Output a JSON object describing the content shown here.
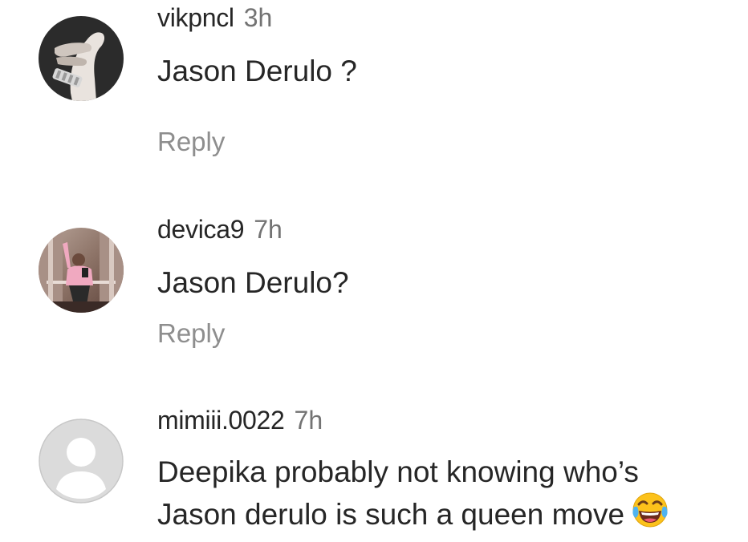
{
  "comments": [
    {
      "username": "vikpncl",
      "time": "3h",
      "text": "Jason Derulo ?",
      "reply_label": "Reply",
      "avatar_icon": "holding-hands-avatar-icon"
    },
    {
      "username": "devica9",
      "time": "7h",
      "text": "Jason Derulo?",
      "reply_label": "Reply",
      "avatar_icon": "mirror-selfie-avatar-icon"
    },
    {
      "username": "mimiii.0022",
      "time": "7h",
      "text_line1": "Deepika probably not knowing who’s",
      "text_line2": "Jason derulo is such a queen move",
      "emoji_icon": "face-with-tears-of-joy-icon",
      "avatar_icon": "default-profile-avatar-icon"
    }
  ],
  "colors": {
    "username": "#262626",
    "timestamp": "#737373",
    "reply": "#8e8e8e",
    "default_avatar_bg": "#dbdbdb"
  }
}
